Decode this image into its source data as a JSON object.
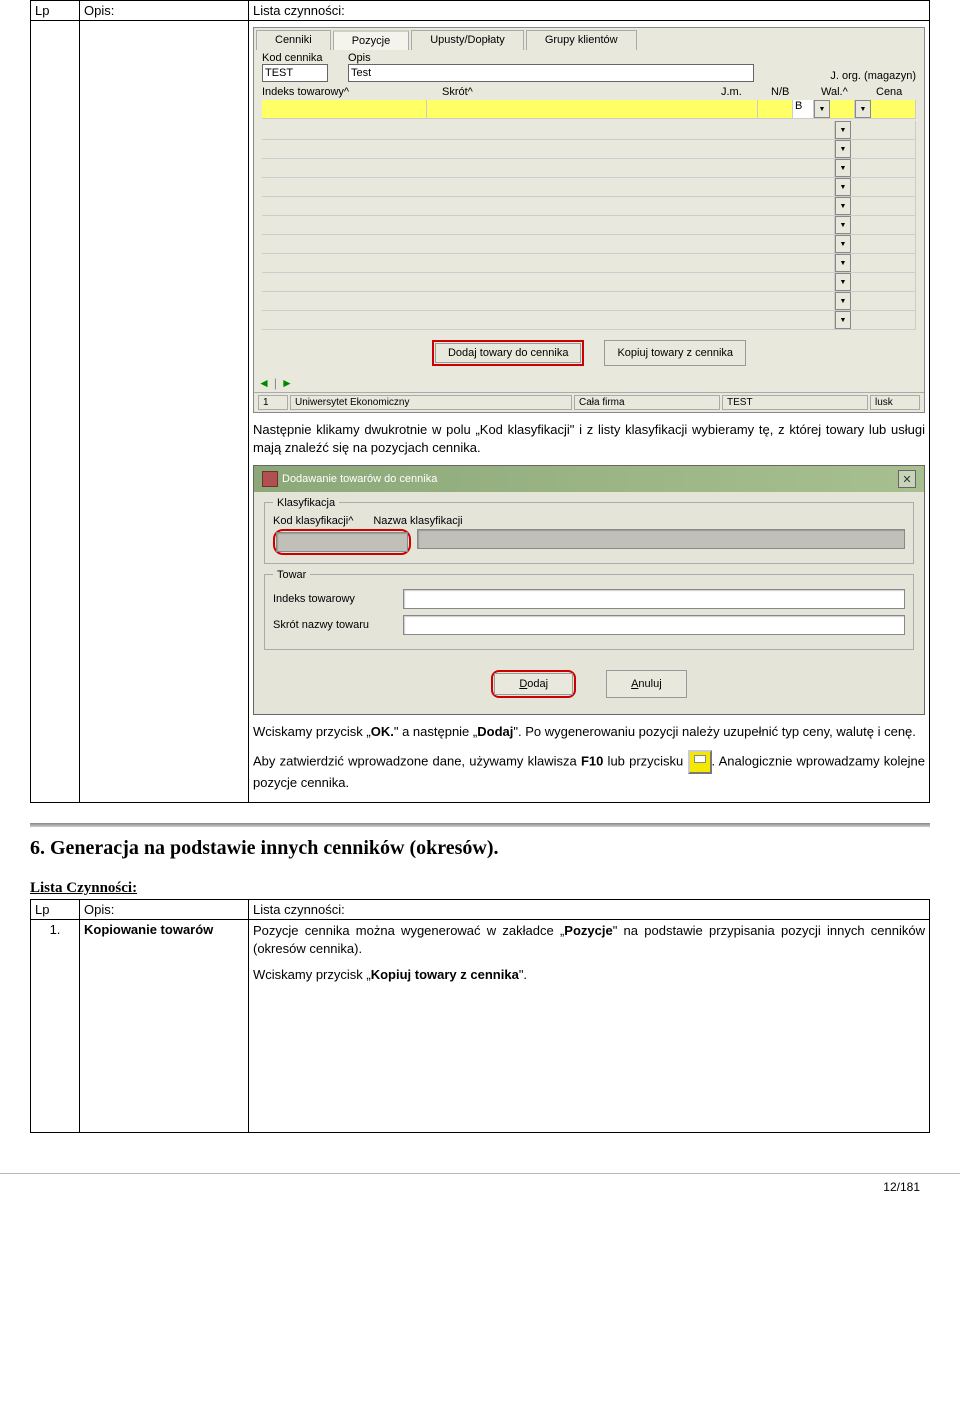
{
  "table1": {
    "headers": {
      "lp": "Lp",
      "opis": "Opis:",
      "lista": "Lista czynności:"
    }
  },
  "shot1": {
    "tabs": [
      "Cenniki",
      "Pozycje",
      "Upusty/Dopłaty",
      "Grupy klientów"
    ],
    "labels": {
      "kod_cennika": "Kod cennika",
      "opis": "Opis",
      "jorg": "J. org. (magazyn)",
      "indeks": "Indeks towarowy^",
      "skrot": "Skrót^",
      "jm": "J.m.",
      "nb": "N/B",
      "wal": "Wal.^",
      "cena": "Cena"
    },
    "values": {
      "kod_cennika": "TEST",
      "opis": "Test",
      "nb_val": "B"
    },
    "buttons": {
      "dodaj": "Dodaj towary do cennika",
      "kopiuj": "Kopiuj towary z cennika"
    },
    "status": {
      "firma": "Uniwersytet Ekonomiczny",
      "scope": "Cała firma",
      "test": "TEST",
      "user": "lusk",
      "count": "1"
    }
  },
  "para1": "Następnie klikamy dwukrotnie w polu „Kod klasyfikacji\" i z listy klasyfikacji wybieramy tę, z której towary lub usługi mają znaleźć się na pozycjach cennika.",
  "dialog": {
    "title": "Dodawanie towarów do cennika",
    "group1": "Klasyfikacja",
    "kod_klas": "Kod klasyfikacji^",
    "nazwa_klas": "Nazwa klasyfikacji",
    "group2": "Towar",
    "indeks": "Indeks towarowy",
    "skrot": "Skrót nazwy towaru",
    "dodaj": "Dodaj",
    "anuluj": "Anuluj"
  },
  "para2_a": "Wciskamy przycisk „",
  "para2_b": "OK.",
  "para2_c": "\" a następnie „",
  "para2_d": "Dodaj",
  "para2_e": "\". Po wygenerowaniu pozycji należy uzupełnić typ ceny, walutę i cenę.",
  "para3_a": "Aby zatwierdzić wprowadzone dane, używamy klawisza ",
  "para3_b": "F10",
  "para3_c": " lub przycisku ",
  "para3_d": ". Analogicznie wprowadzamy kolejne pozycje cennika.",
  "section6": "6. Generacja na podstawie innych cenników (okresów).",
  "lista_heading": "Lista Czynności:",
  "table2": {
    "headers": {
      "lp": "Lp",
      "opis": "Opis:",
      "lista": "Lista czynności:"
    },
    "row": {
      "lp": "1.",
      "opis": "Kopiowanie towarów",
      "text_a": "Pozycje cennika można wygenerować w zakładce „",
      "text_b": "Pozycje",
      "text_c": "\" na podstawie przypisania pozycji innych cenników (okresów cennika).",
      "text2_a": "Wciskamy przycisk „",
      "text2_b": "Kopiuj towary z cennika",
      "text2_c": "\"."
    }
  },
  "footer": "12/181"
}
